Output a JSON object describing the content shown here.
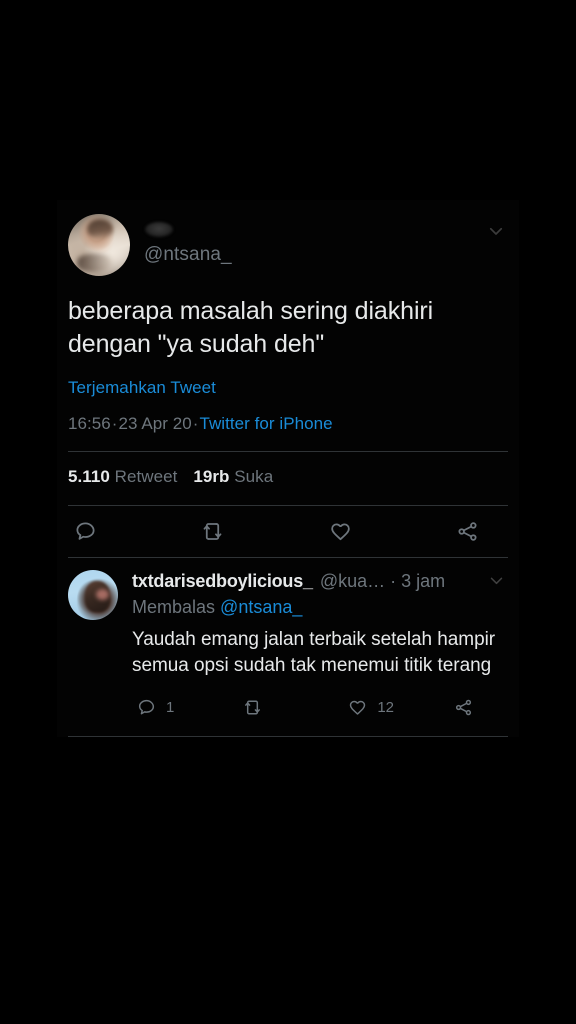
{
  "theme": {
    "background": "#000000",
    "content_background": "#030303",
    "text_primary": "#e7e9ea",
    "text_secondary": "#6e767d",
    "link": "#1a8cd8",
    "divider": "#2f3336"
  },
  "tweet": {
    "display_name": "",
    "display_name_state": "redacted",
    "handle": "@ntsana_",
    "avatar_alt": "profile-photo-child",
    "caret_icon": "chevron-down-icon",
    "text": "beberapa masalah sering diakhiri dengan \"ya sudah deh\"",
    "translate_label": "Terjemahkan Tweet",
    "time": "16:56",
    "separator": "·",
    "date": "23 Apr 20",
    "source": "Twitter for iPhone",
    "stats": [
      {
        "count": "5.110",
        "label": "Retweet"
      },
      {
        "count": "19rb",
        "label": "Suka"
      }
    ],
    "actions": [
      {
        "icon": "reply-icon",
        "count": ""
      },
      {
        "icon": "retweet-icon",
        "count": ""
      },
      {
        "icon": "like-icon",
        "count": ""
      },
      {
        "icon": "share-icon",
        "count": ""
      }
    ]
  },
  "reply": {
    "display_name": "txtdarisedboylicious_",
    "handle": "@kua…",
    "separator": "·",
    "time": "3 jam",
    "caret_icon": "chevron-down-icon",
    "replying_prefix": "Membalas",
    "replying_to": "@ntsana_",
    "avatar_alt": "profile-photo-sky",
    "text": "Yaudah emang jalan terbaik setelah hampir semua opsi sudah tak menemui titik terang",
    "actions": [
      {
        "icon": "reply-icon",
        "count": "1"
      },
      {
        "icon": "retweet-icon",
        "count": ""
      },
      {
        "icon": "like-icon",
        "count": "12"
      },
      {
        "icon": "share-icon",
        "count": ""
      }
    ]
  }
}
